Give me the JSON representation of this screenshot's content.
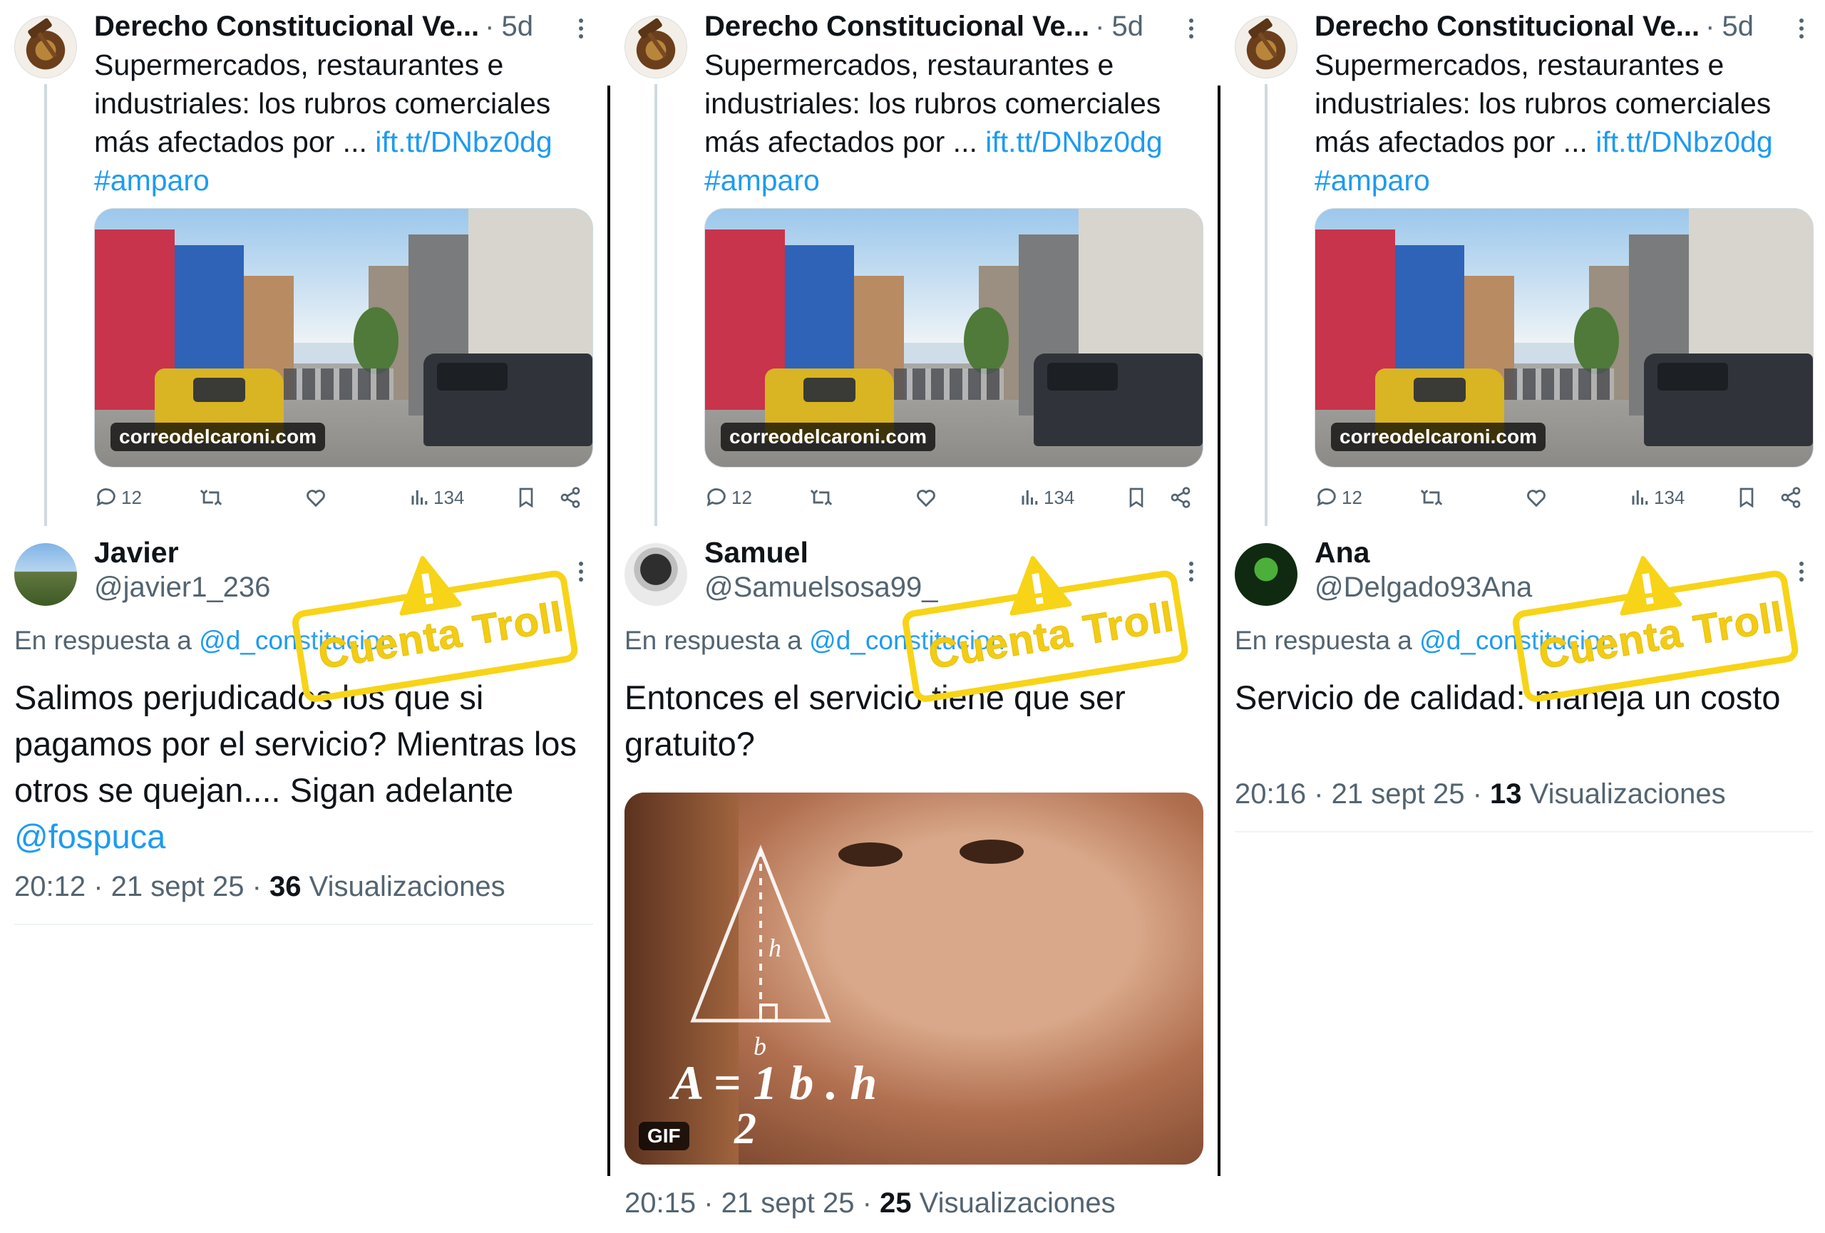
{
  "original_tweet": {
    "author": "Derecho Constitucional Ve...",
    "time": "5d",
    "text_lines": [
      "Supermercados, restaurantes e",
      "industriales: los rubros comerciales",
      "más afectados por ... "
    ],
    "link": "ift.tt/DNbz0dg",
    "hashtag": "#amparo",
    "media_label": "correodelcaroni.com",
    "stats": {
      "replies": "12",
      "views": "134"
    }
  },
  "stamp_text": "Cuenta Troll",
  "colors": {
    "link": "#1d9bf0",
    "stamp": "#f7d417",
    "muted": "#536471"
  },
  "icons": [
    "avatar-gavel-icon",
    "more-icon",
    "reply-icon",
    "retweet-icon",
    "like-icon",
    "views-icon",
    "bookmark-icon",
    "share-icon",
    "warning-icon"
  ],
  "replies": [
    {
      "name": "Javier",
      "handle": "@javier1_236",
      "reply_prefix": "En respuesta a ",
      "reply_to": "@d_constitucion",
      "text": "Salimos perjudicados los que si pagamos por el servicio? Mientras los otros se quejan.... Sigan adelante ",
      "mention": "@fospuca",
      "time": "20:12 · 21 sept 25 · ",
      "views": "36",
      "views_label": " Visualizaciones"
    },
    {
      "name": "Samuel",
      "handle": "@Samuelsosa99_",
      "reply_prefix": "En respuesta a ",
      "reply_to": "@d_constitucion",
      "text": "Entonces el servicio tiene que ser gratuito?",
      "gif_label": "GIF",
      "gif_formula": "A = 1 b . h",
      "gif_formula_h": "h",
      "gif_formula_b": "b",
      "gif_formula_den": "2",
      "time": "20:15 · 21 sept 25 · ",
      "views": "25",
      "views_label": " Visualizaciones"
    },
    {
      "name": "Ana",
      "handle": "@Delgado93Ana",
      "reply_prefix": "En respuesta a ",
      "reply_to": "@d_constitucion",
      "text": "Servicio de calidad: maneja un costo",
      "time": "20:16 · 21 sept 25 · ",
      "views": "13",
      "views_label": " Visualizaciones"
    }
  ]
}
